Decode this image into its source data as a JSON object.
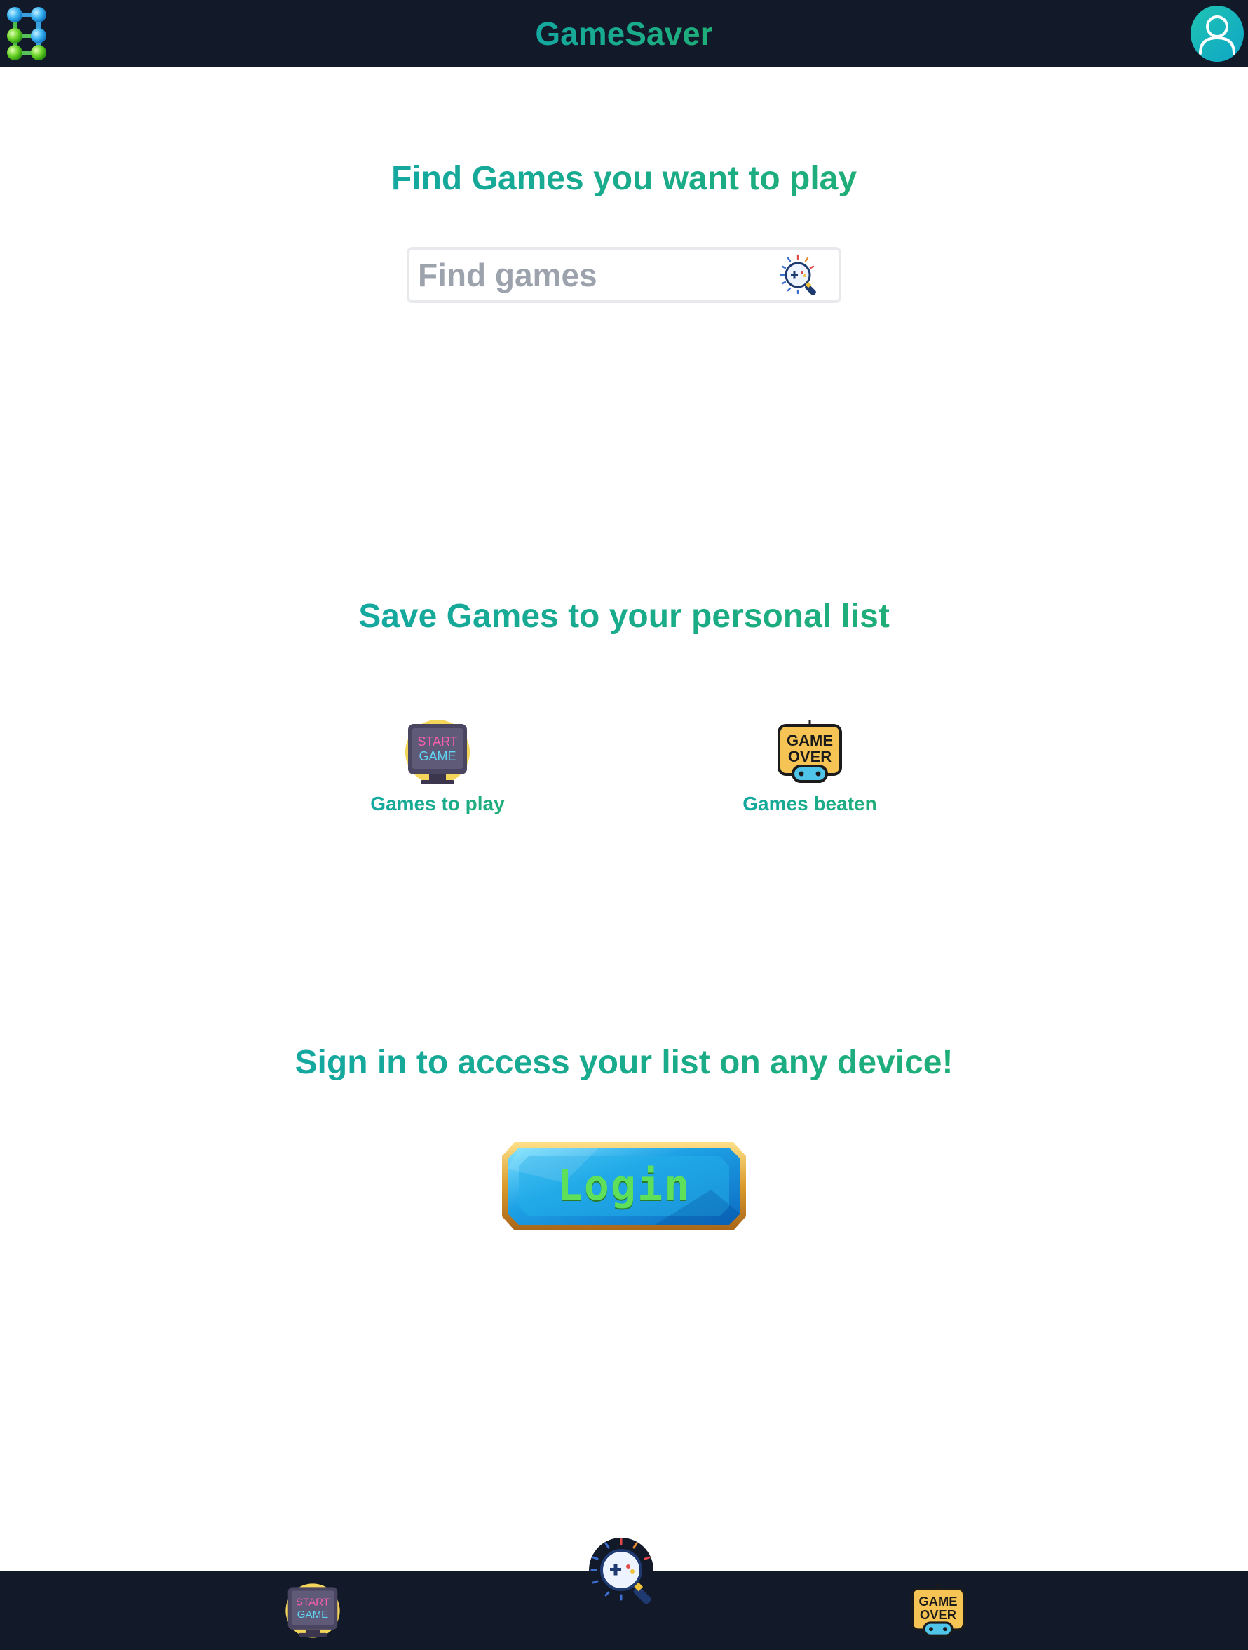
{
  "header": {
    "title": "GameSaver",
    "logo_icon": "connected-dots-logo-icon",
    "profile_icon": "user-profile-icon"
  },
  "find_section": {
    "heading": "Find Games you want to play",
    "search": {
      "placeholder": "Find games",
      "value": "",
      "button_icon": "game-search-icon"
    }
  },
  "save_section": {
    "heading": "Save Games to your personal list",
    "lists": [
      {
        "label": "Games to play",
        "icon": "start-game-icon",
        "icon_text": [
          "START",
          "GAME"
        ]
      },
      {
        "label": "Games beaten",
        "icon": "game-over-icon",
        "icon_text": [
          "GAME",
          "OVER"
        ]
      }
    ]
  },
  "signin_section": {
    "heading": "Sign in to access your list on any device!",
    "login_label": "Login"
  },
  "bottom_nav": {
    "items": [
      {
        "name": "games-to-play",
        "icon": "start-game-icon"
      },
      {
        "name": "search",
        "icon": "game-search-icon"
      },
      {
        "name": "games-beaten",
        "icon": "game-over-icon"
      }
    ]
  },
  "colors": {
    "bar_background": "#121a2a",
    "accent_teal": "#14a8a0",
    "accent_green": "#1fae78",
    "placeholder_gray": "#9ca3ad"
  }
}
